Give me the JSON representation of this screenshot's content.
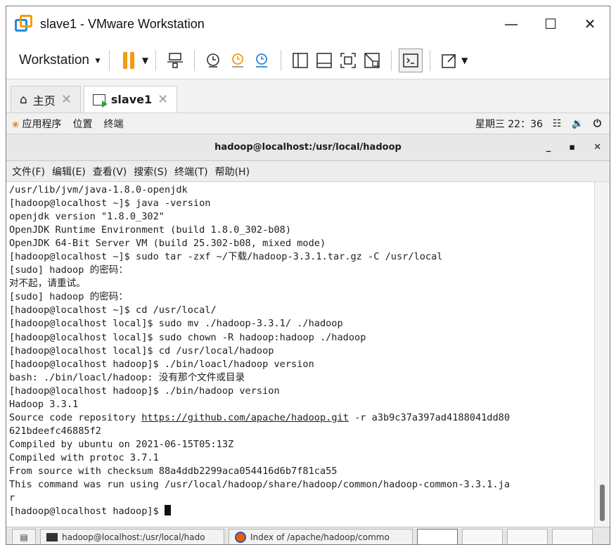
{
  "window": {
    "title": "slave1 - VMware Workstation"
  },
  "toolbar": {
    "menu_label": "Workstation"
  },
  "vm_tabs": [
    {
      "label": "主页"
    },
    {
      "label": "slave1"
    }
  ],
  "gnome": {
    "applications": "应用程序",
    "places": "位置",
    "terminal": "终端",
    "clock": "星期三 22：36"
  },
  "terminal": {
    "title": "hadoop@localhost:/usr/local/hadoop",
    "menu": [
      "文件(F)",
      "编辑(E)",
      "查看(V)",
      "搜索(S)",
      "终端(T)",
      "帮助(H)"
    ],
    "lines": [
      "/usr/lib/jvm/java-1.8.0-openjdk",
      "[hadoop@localhost ~]$ java -version",
      "openjdk version \"1.8.0_302\"",
      "OpenJDK Runtime Environment (build 1.8.0_302-b08)",
      "OpenJDK 64-Bit Server VM (build 25.302-b08, mixed mode)",
      "[hadoop@localhost ~]$ sudo tar -zxf ~/下载/hadoop-3.3.1.tar.gz -C /usr/local",
      "[sudo] hadoop 的密码：",
      "对不起，请重试。",
      "[sudo] hadoop 的密码：",
      "[hadoop@localhost ~]$ cd /usr/local/",
      "[hadoop@localhost local]$ sudo mv ./hadoop-3.3.1/ ./hadoop",
      "[hadoop@localhost local]$ sudo chown -R hadoop:hadoop ./hadoop",
      "[hadoop@localhost local]$ cd /usr/local/hadoop",
      "[hadoop@localhost hadoop]$ ./bin/loacl/hadoop version",
      "bash: ./bin/loacl/hadoop: 没有那个文件或目录",
      "[hadoop@localhost hadoop]$ ./bin/hadoop version",
      "Hadoop 3.3.1"
    ],
    "repo_prefix": "Source code repository ",
    "repo_url": "https://github.com/apache/hadoop.git",
    "repo_suffix": " -r a3b9c37a397ad4188041dd80",
    "lines_after": [
      "621bdeefc46885f2",
      "Compiled by ubuntu on 2021-06-15T05:13Z",
      "Compiled with protoc 3.7.1",
      "From source with checksum 88a4ddb2299aca054416d6b7f81ca55",
      "This command was run using /usr/local/hadoop/share/hadoop/common/hadoop-common-3.3.1.ja",
      "r"
    ],
    "prompt": "[hadoop@localhost hadoop]$ "
  },
  "taskbar": {
    "items": [
      {
        "label": "hadoop@localhost:/usr/local/hado"
      },
      {
        "label": "Index of /apache/hadoop/commo"
      }
    ]
  }
}
